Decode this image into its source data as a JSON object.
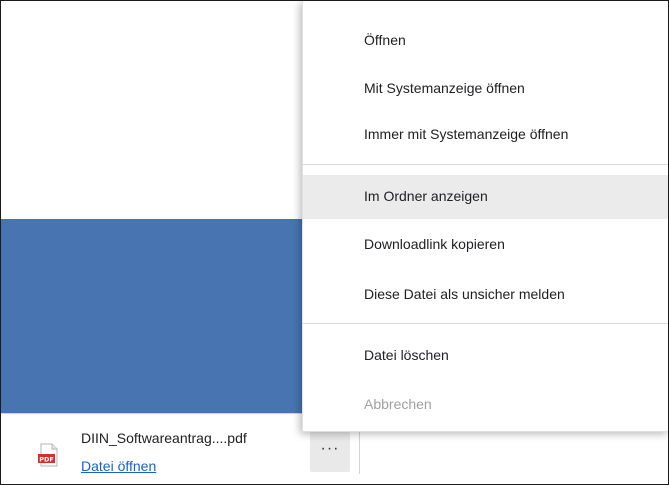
{
  "download": {
    "file_name": "DIIN_Softwareantrag....pdf",
    "open_link": "Datei öffnen",
    "more_button": "···",
    "file_icon": "pdf-file-icon",
    "file_icon_text": "PDF"
  },
  "context_menu": {
    "items": [
      {
        "label": "Öffnen"
      },
      {
        "label": "Mit Systemanzeige öffnen"
      },
      {
        "label": "Immer mit Systemanzeige öffnen"
      },
      {
        "label": "Im Ordner anzeigen"
      },
      {
        "label": "Downloadlink kopieren"
      },
      {
        "label": "Diese Datei als unsicher melden"
      },
      {
        "label": "Datei löschen"
      },
      {
        "label": "Abbrechen"
      }
    ]
  },
  "colors": {
    "page_band": "#4875b1",
    "link": "#1a62c8",
    "highlight": "#ebebeb",
    "pdf_red": "#d32f2f"
  }
}
